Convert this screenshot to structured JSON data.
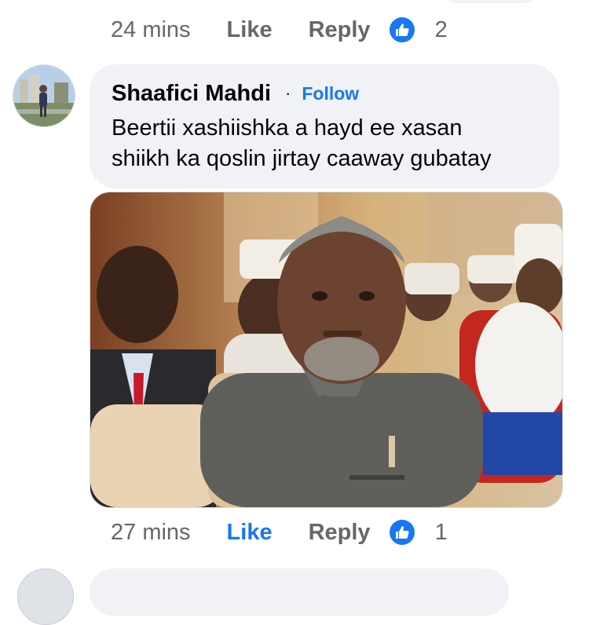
{
  "previous_comment": {
    "time": "24 mins",
    "like_label": "Like",
    "reply_label": "Reply",
    "reaction_count": "2"
  },
  "comment": {
    "author": "Shaafici Mahdi",
    "separator": "·",
    "follow_label": "Follow",
    "text_line1": "Beertii xashiishka a hayd ee xasan",
    "text_line2": "shiikh ka qoslin jirtay caaway gubatay",
    "time": "27 mins",
    "like_label": "Like",
    "reply_label": "Reply",
    "reaction_count": "1",
    "like_active": true
  },
  "colors": {
    "accent": "#1877f2",
    "bubble_bg": "#f0f2f5",
    "meta_text": "#65676b",
    "body_text": "#050505"
  },
  "icons": {
    "reaction": "thumbs-up-icon",
    "avatar": "profile-photo"
  }
}
